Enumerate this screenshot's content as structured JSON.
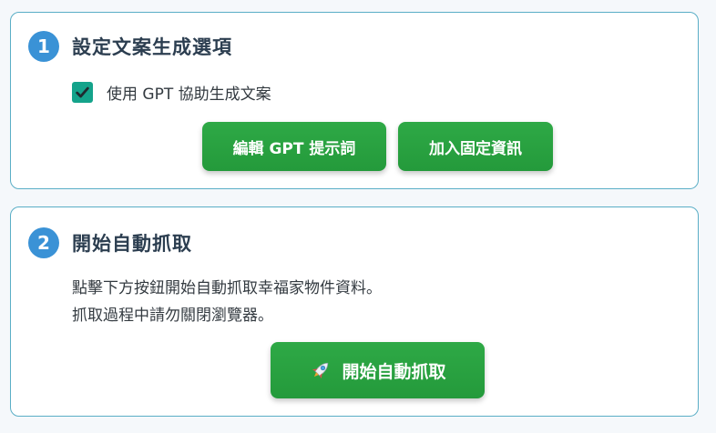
{
  "step1": {
    "number": "1",
    "title": "設定文案生成選項",
    "checkbox": {
      "label": "使用 GPT 協助生成文案",
      "checked": true
    },
    "buttons": {
      "edit_prompt": "編輯 GPT 提示詞",
      "add_fixed_info": "加入固定資訊"
    }
  },
  "step2": {
    "number": "2",
    "title": "開始自動抓取",
    "description_line1": "點擊下方按鈕開始自動抓取幸福家物件資料。",
    "description_line2": "抓取過程中請勿關閉瀏覽器。",
    "start_button": "開始自動抓取",
    "start_button_icon": "rocket-icon"
  },
  "colors": {
    "accent_blue": "#3a92d6",
    "card_border": "#5aaec6",
    "button_green": "#2ea946",
    "checkbox_teal": "#14a38b"
  }
}
